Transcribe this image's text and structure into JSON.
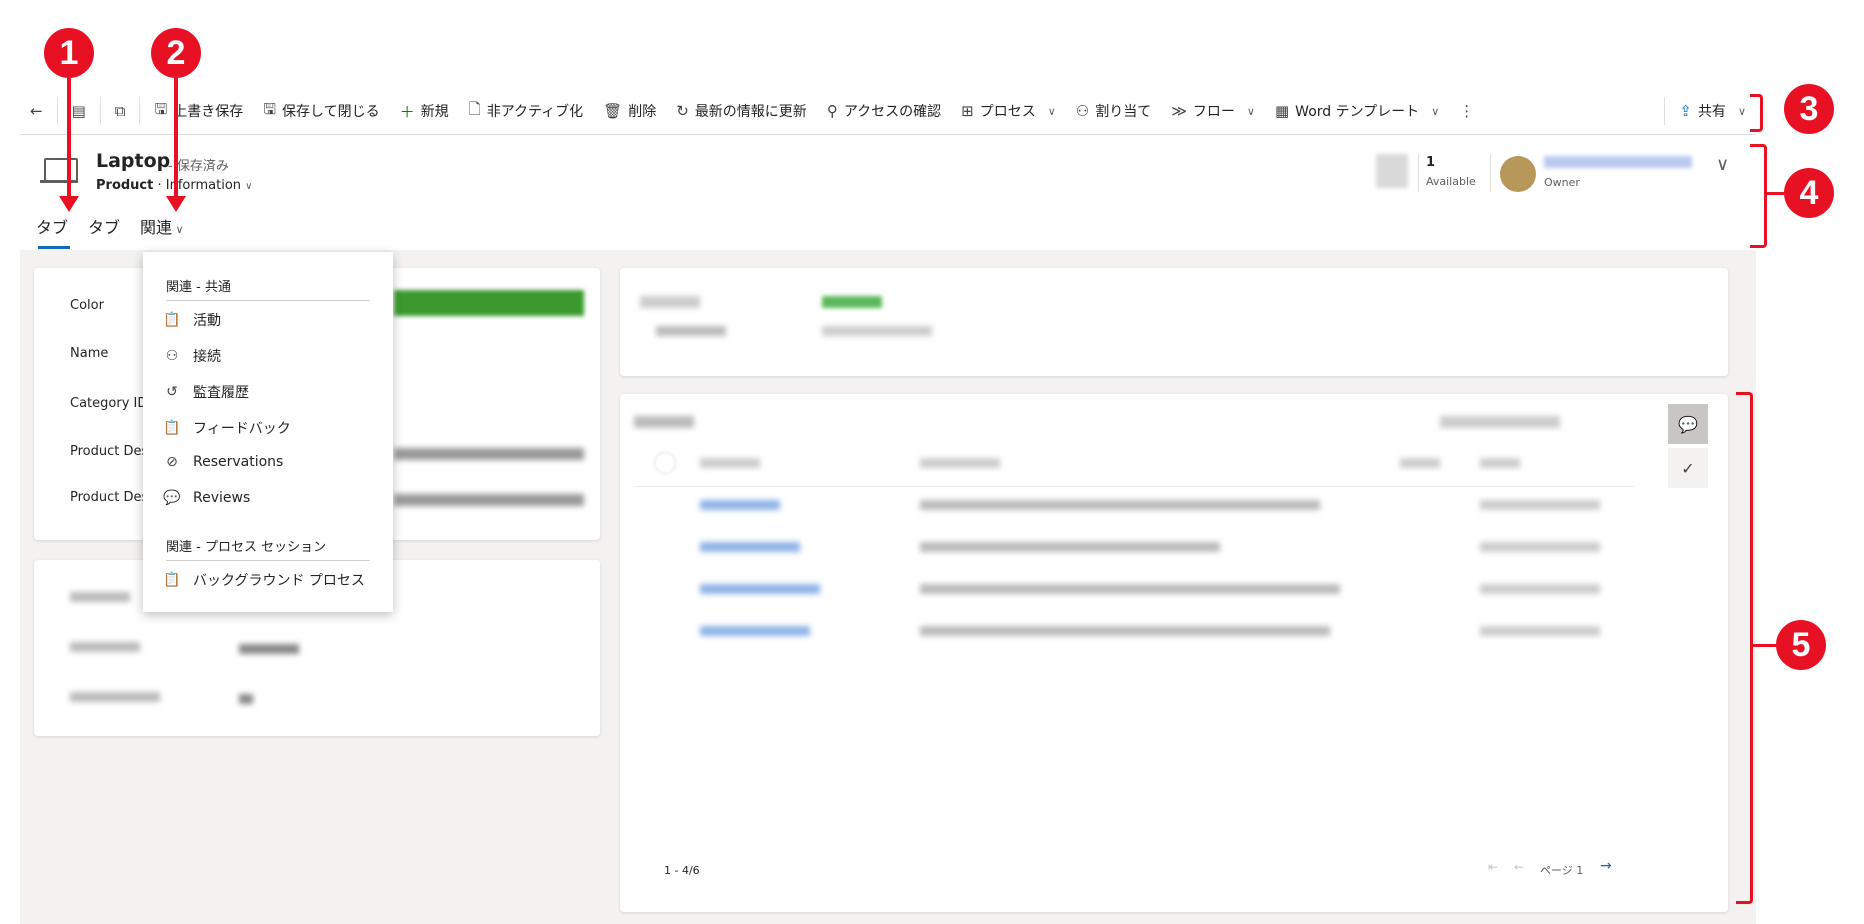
{
  "toolbar": {
    "items": [
      {
        "label": "上書き保存",
        "icon": "save-icon"
      },
      {
        "label": "保存して閉じる",
        "icon": "save-close-icon"
      },
      {
        "label": "新規",
        "icon": "plus-icon"
      },
      {
        "label": "非アクティブ化",
        "icon": "deactivate-icon"
      },
      {
        "label": "削除",
        "icon": "delete-icon"
      },
      {
        "label": "最新の情報に更新",
        "icon": "refresh-icon"
      },
      {
        "label": "アクセスの確認",
        "icon": "key-icon"
      },
      {
        "label": "プロセス",
        "icon": "process-icon"
      },
      {
        "label": "割り当て",
        "icon": "assign-icon"
      },
      {
        "label": "フロー",
        "icon": "flow-icon"
      },
      {
        "label": "Word テンプレート",
        "icon": "word-icon"
      }
    ],
    "share_label": "共有"
  },
  "record": {
    "title": "Laptop",
    "status": "- 保存済み",
    "entity": "Product",
    "form": "Information",
    "kpi_value": "1",
    "kpi_label": "Available",
    "owner_label": "Owner"
  },
  "tabs": [
    "タブ",
    "タブ",
    "関連"
  ],
  "fields": [
    "Color",
    "Name",
    "Category ID",
    "Product Des",
    "Product Des"
  ],
  "dropdown": {
    "section1": "関連 - 共通",
    "items1": [
      {
        "label": "活動",
        "icon": "clipboard-icon"
      },
      {
        "label": "接続",
        "icon": "people-icon"
      },
      {
        "label": "監査履歴",
        "icon": "history-icon"
      },
      {
        "label": "フィードバック",
        "icon": "feedback-icon"
      },
      {
        "label": "Reservations",
        "icon": "check-circle-icon"
      },
      {
        "label": "Reviews",
        "icon": "comment-icon"
      }
    ],
    "section2": "関連 - プロセス セッション",
    "items2": [
      {
        "label": "バックグラウンド プロセス",
        "icon": "clipboard-icon"
      }
    ]
  },
  "reviews_grid": {
    "range": "1 - 4/6",
    "page": "ページ 1"
  },
  "annotations": [
    "1",
    "2",
    "3",
    "4",
    "5"
  ],
  "colors": {
    "accent": "#0f6cbd",
    "annotation": "#e81123",
    "rating": "#107c10"
  }
}
